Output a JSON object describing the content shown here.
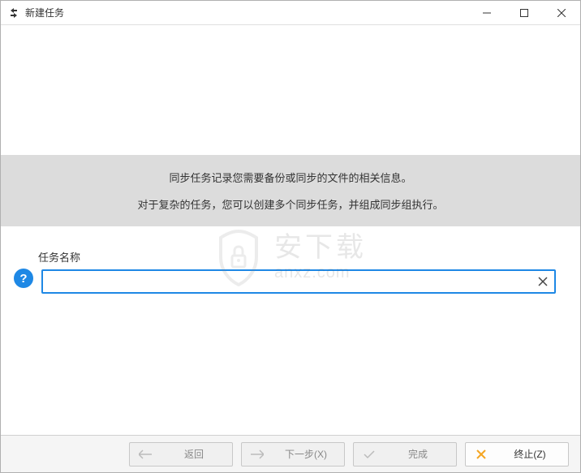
{
  "window": {
    "title": "新建任务"
  },
  "info": {
    "line1": "同步任务记录您需要备份或同步的文件的相关信息。",
    "line2": "对于复杂的任务，您可以创建多个同步任务，并组成同步组执行。"
  },
  "form": {
    "task_name_label": "任务名称",
    "task_name_value": "",
    "help_symbol": "?"
  },
  "watermark": {
    "cn": "安下载",
    "en": "anxz.com"
  },
  "footer": {
    "back_label": "返回",
    "next_label": "下一步(X)",
    "finish_label": "完成",
    "cancel_label": "终止(Z)"
  }
}
